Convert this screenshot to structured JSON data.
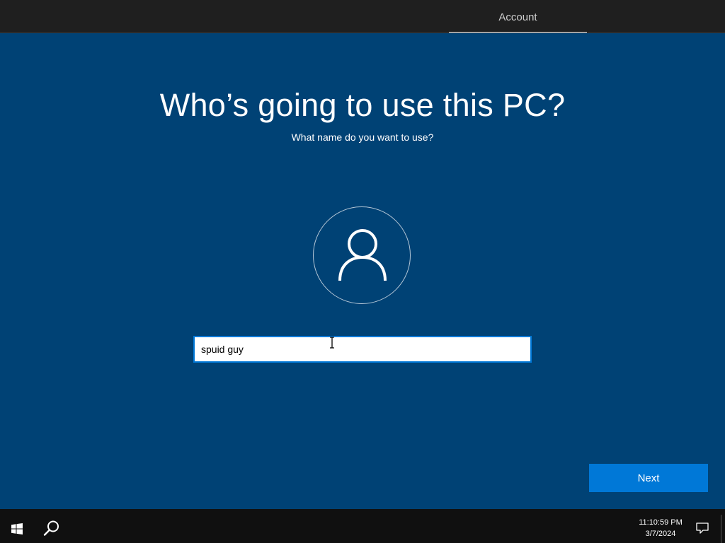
{
  "header": {
    "steps": [
      {
        "label": "Account"
      }
    ]
  },
  "page": {
    "title": "Who’s going to use this PC?",
    "subtitle": "What name do you want to use?"
  },
  "form": {
    "name_value": "spuid guy"
  },
  "actions": {
    "next_label": "Next"
  },
  "taskbar": {
    "time": "11:10:59 PM",
    "date": "3/7/2024"
  },
  "icons": {
    "avatar": "user-icon",
    "start": "windows-logo-icon",
    "search": "search-icon",
    "notifications": "action-center-icon"
  },
  "colors": {
    "background": "#004275",
    "topbar": "#1f1f1f",
    "accent": "#0078d7",
    "taskbar": "#101010"
  }
}
